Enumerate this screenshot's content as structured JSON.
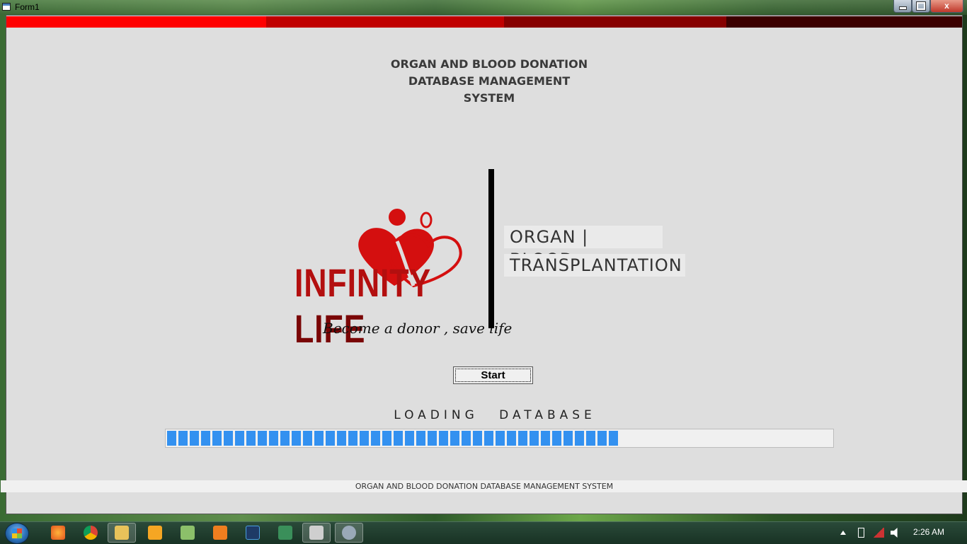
{
  "window": {
    "title": "Form1",
    "minimize_label": "",
    "maximize_label": "",
    "close_label": "x"
  },
  "top_bar_colors": [
    "#ff0000",
    "#c00000",
    "#860000",
    "#3c0000"
  ],
  "header": {
    "line1": "ORGAN AND BLOOD DONATION",
    "line2": "DATABASE MANAGEMENT",
    "line3": "SYSTEM"
  },
  "logo": {
    "brand_word1": "INFINITY",
    "brand_word2": "LIFE",
    "tagline": "Become a donor , save life",
    "brand_color": "#c20f0f"
  },
  "labels": {
    "organ_blood": "ORGAN | BLOOD",
    "transplantation": "TRANSPLANTATION"
  },
  "start_button": {
    "label": "Start"
  },
  "loading": {
    "label": "LOADING DATABASE",
    "progress_percent": 68,
    "bar_color": "#3391f0"
  },
  "status_strip": {
    "text": "ORGAN AND BLOOD DONATION DATABASE MANAGEMENT SYSTEM"
  },
  "taskbar": {
    "apps": [
      "firefox-icon",
      "chrome-icon",
      "explorer-icon",
      "media-player-icon",
      "notepad-icon",
      "sublime-icon",
      "photoshop-icon",
      "app-icon",
      "form-app-icon",
      "paint-icon"
    ],
    "clock": "2:26 AM"
  }
}
